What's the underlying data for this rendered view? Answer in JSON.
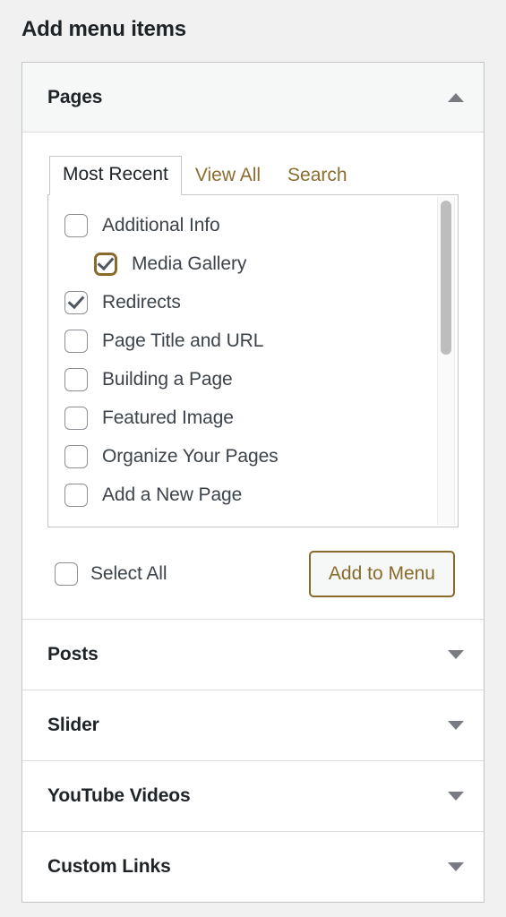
{
  "page": {
    "title": "Add menu items",
    "background_color": "#f1f1f1",
    "accent_color": "#8a6d2f"
  },
  "panels": [
    {
      "id": "pages",
      "title": "Pages",
      "expanded": true,
      "toggle_icon": "chevron-up-icon"
    },
    {
      "id": "posts",
      "title": "Posts",
      "expanded": false,
      "toggle_icon": "chevron-down-icon"
    },
    {
      "id": "slider",
      "title": "Slider",
      "expanded": false,
      "toggle_icon": "chevron-down-icon"
    },
    {
      "id": "youtube-videos",
      "title": "YouTube Videos",
      "expanded": false,
      "toggle_icon": "chevron-down-icon"
    },
    {
      "id": "custom-links",
      "title": "Custom Links",
      "expanded": false,
      "toggle_icon": "chevron-down-icon"
    }
  ],
  "pages_panel": {
    "tabs": [
      {
        "label": "Most Recent",
        "active": true
      },
      {
        "label": "View All",
        "active": false
      },
      {
        "label": "Search",
        "active": false
      }
    ],
    "items": [
      {
        "label": "Additional Info",
        "checked": false,
        "child": false,
        "focused": false
      },
      {
        "label": "Media Gallery",
        "checked": true,
        "child": true,
        "focused": true
      },
      {
        "label": "Redirects",
        "checked": true,
        "child": false,
        "focused": false
      },
      {
        "label": "Page Title and URL",
        "checked": false,
        "child": false,
        "focused": false
      },
      {
        "label": "Building a Page",
        "checked": false,
        "child": false,
        "focused": false
      },
      {
        "label": "Featured Image",
        "checked": false,
        "child": false,
        "focused": false
      },
      {
        "label": "Organize Your Pages",
        "checked": false,
        "child": false,
        "focused": false
      },
      {
        "label": "Add a New Page",
        "checked": false,
        "child": false,
        "focused": false
      }
    ],
    "select_all": {
      "label": "Select All",
      "checked": false
    },
    "add_button": {
      "label": "Add to Menu",
      "border_color": "#8a6a2a",
      "text_color": "#8a6a2a"
    },
    "scrollbar": {
      "thumb_top_percent": 1,
      "thumb_height_percent": 46
    }
  }
}
